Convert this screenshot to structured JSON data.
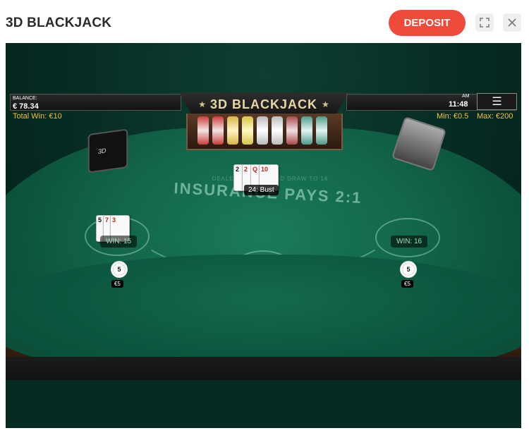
{
  "header": {
    "title": "3D BLACKJACK",
    "deposit_label": "DEPOSIT",
    "expand_icon": "expand-icon",
    "close_icon": "close-icon"
  },
  "game": {
    "logo": "3D BLACKJACK",
    "balance_label": "BALANCE:",
    "balance_value": "€ 78.34",
    "total_win": "Total Win: €10",
    "clock_ampm": "AM",
    "clock_time": "11:48",
    "min_bet": "Min: €0.5",
    "max_bet": "Max: €200",
    "table_text": "INSURANCE PAYS 2:1",
    "dealer_rule": "DEALER MUST ... AND DRAW TO 16",
    "dealer_hand": {
      "label": "24: Bust",
      "cards": [
        {
          "rank": "2",
          "color": "black"
        },
        {
          "rank": "2",
          "color": "red"
        },
        {
          "rank": "Q",
          "color": "red"
        },
        {
          "rank": "10",
          "color": "red"
        }
      ]
    },
    "player_hands": [
      {
        "win": "WIN: 15",
        "chip": "5",
        "bet": "€5",
        "cards": [
          {
            "rank": "5",
            "color": "black"
          },
          {
            "rank": "7",
            "color": "red"
          },
          {
            "rank": "3",
            "color": "red"
          }
        ]
      },
      {
        "win": "WIN: 16",
        "chip": "5",
        "bet": "€5",
        "cards": []
      }
    ],
    "colors": {
      "accent": "#ef4b3a",
      "gold_text": "#f3c234",
      "felt": "#12664b"
    }
  }
}
